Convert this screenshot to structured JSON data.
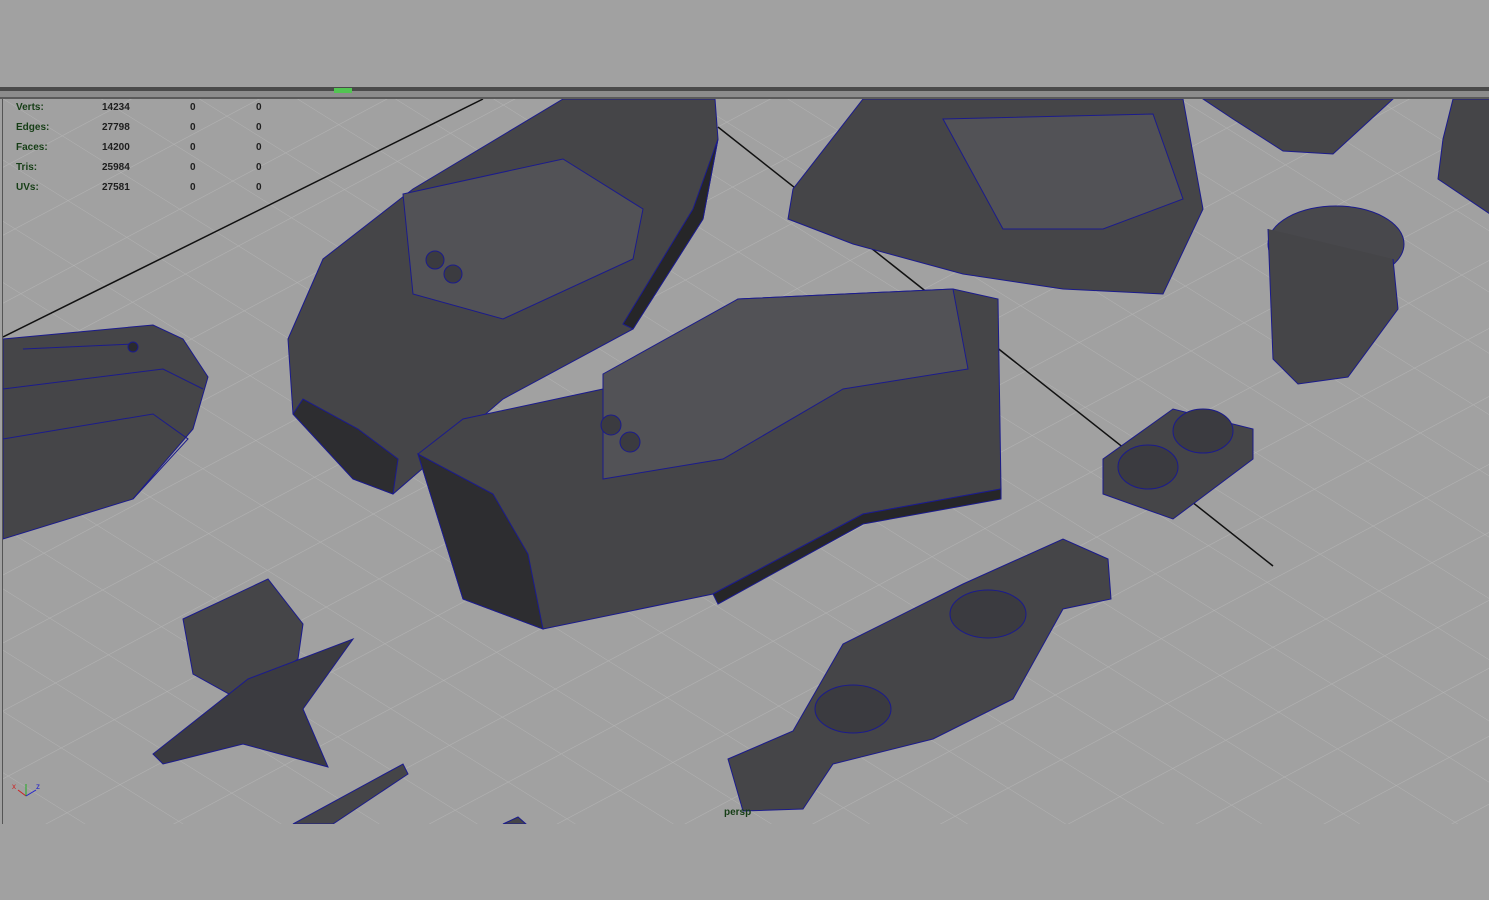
{
  "hud": {
    "stats": [
      {
        "label": "Verts:",
        "values": [
          "14234",
          "0",
          "0"
        ]
      },
      {
        "label": "Edges:",
        "values": [
          "27798",
          "0",
          "0"
        ]
      },
      {
        "label": "Faces:",
        "values": [
          "14200",
          "0",
          "0"
        ]
      },
      {
        "label": "Tris:",
        "values": [
          "25984",
          "0",
          "0"
        ]
      },
      {
        "label": "UVs:",
        "values": [
          "27581",
          "0",
          "0"
        ]
      }
    ]
  },
  "camera": {
    "label": "persp"
  },
  "axis": {
    "x_label": "x",
    "z_label": "z"
  },
  "colors": {
    "background": "#a1a1a1",
    "grid": "#b4b4b4",
    "mesh_fill": "#454548",
    "mesh_dark": "#262628",
    "wire": "#1b1b8c",
    "hud_text": "#163e16"
  },
  "icons": [
    "axis-gizmo-icon",
    "selection-indicator-icon"
  ]
}
